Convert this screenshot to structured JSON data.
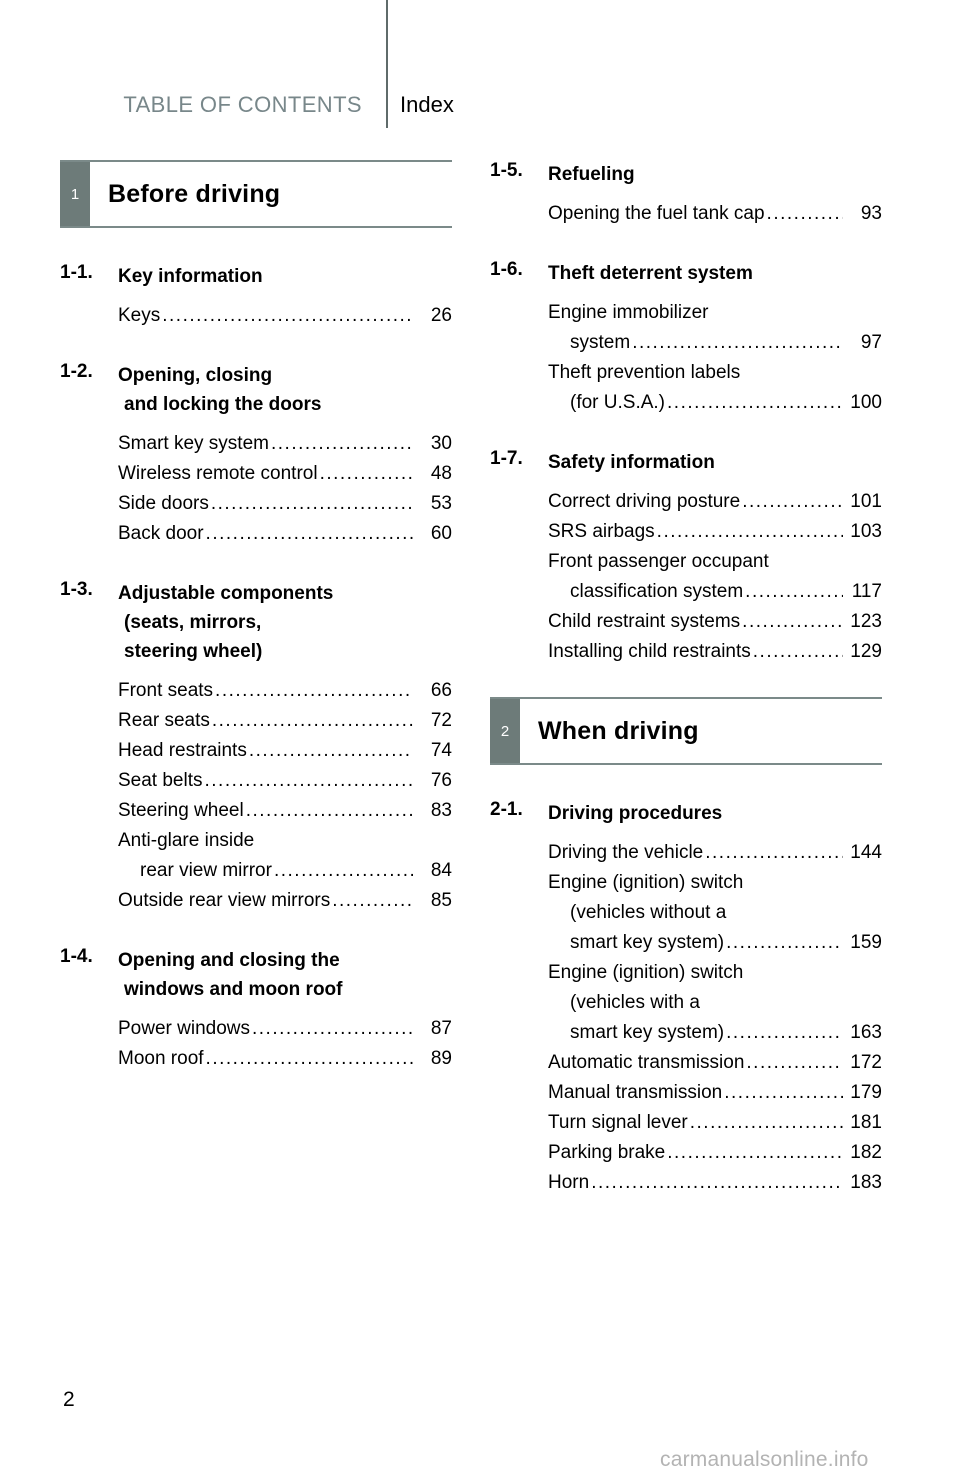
{
  "header": {
    "toc_label": "TABLE OF CONTENTS",
    "index_label": "Index"
  },
  "footer": {
    "page_number": "2",
    "watermark": "carmanualsonline.info"
  },
  "colors": {
    "tab_background": "#6d7b79",
    "rule": "#7b8a89",
    "toc_text": "#78878a",
    "watermark": "#b3b3b3"
  },
  "left_column": {
    "chapter": {
      "number": "1",
      "title": "Before driving"
    },
    "sections": [
      {
        "number": "1-1.",
        "title_lines": [
          "Key information"
        ],
        "entries": [
          {
            "lines": [
              "Keys"
            ],
            "page": "26"
          }
        ]
      },
      {
        "number": "1-2.",
        "title_lines": [
          "Opening, closing",
          "and locking the doors"
        ],
        "entries": [
          {
            "lines": [
              "Smart key system"
            ],
            "page": "30"
          },
          {
            "lines": [
              "Wireless remote control"
            ],
            "page": "48"
          },
          {
            "lines": [
              "Side doors"
            ],
            "page": "53"
          },
          {
            "lines": [
              "Back door"
            ],
            "page": "60"
          }
        ]
      },
      {
        "number": "1-3.",
        "title_lines": [
          "Adjustable components",
          "(seats, mirrors,",
          "steering wheel)"
        ],
        "entries": [
          {
            "lines": [
              "Front seats"
            ],
            "page": "66"
          },
          {
            "lines": [
              "Rear seats"
            ],
            "page": "72"
          },
          {
            "lines": [
              "Head restraints"
            ],
            "page": "74"
          },
          {
            "lines": [
              "Seat belts"
            ],
            "page": "76"
          },
          {
            "lines": [
              "Steering wheel"
            ],
            "page": "83"
          },
          {
            "lines": [
              "Anti-glare inside",
              "rear view mirror"
            ],
            "page": "84"
          },
          {
            "lines": [
              "Outside rear view mirrors"
            ],
            "page": "85"
          }
        ]
      },
      {
        "number": "1-4.",
        "title_lines": [
          "Opening and closing the",
          "windows and moon roof"
        ],
        "entries": [
          {
            "lines": [
              "Power windows"
            ],
            "page": "87"
          },
          {
            "lines": [
              "Moon roof"
            ],
            "page": "89"
          }
        ]
      }
    ]
  },
  "right_column": {
    "sections_before_chapter": [
      {
        "number": "1-5.",
        "title_lines": [
          "Refueling"
        ],
        "entries": [
          {
            "lines": [
              "Opening the fuel tank cap"
            ],
            "page": "93"
          }
        ]
      },
      {
        "number": "1-6.",
        "title_lines": [
          "Theft deterrent system"
        ],
        "entries": [
          {
            "lines": [
              "Engine immobilizer",
              "system"
            ],
            "page": "97"
          },
          {
            "lines": [
              "Theft prevention labels",
              "(for U.S.A.)"
            ],
            "page": "100"
          }
        ]
      },
      {
        "number": "1-7.",
        "title_lines": [
          "Safety information"
        ],
        "entries": [
          {
            "lines": [
              "Correct driving posture"
            ],
            "page": "101"
          },
          {
            "lines": [
              "SRS airbags"
            ],
            "page": "103"
          },
          {
            "lines": [
              "Front passenger occupant",
              "classification system"
            ],
            "page": "117"
          },
          {
            "lines": [
              "Child restraint systems"
            ],
            "page": "123"
          },
          {
            "lines": [
              "Installing child restraints"
            ],
            "page": "129"
          }
        ]
      }
    ],
    "chapter": {
      "number": "2",
      "title": "When driving"
    },
    "sections_after_chapter": [
      {
        "number": "2-1.",
        "title_lines": [
          "Driving procedures"
        ],
        "entries": [
          {
            "lines": [
              "Driving the vehicle"
            ],
            "page": "144"
          },
          {
            "lines": [
              "Engine (ignition) switch",
              "(vehicles without a",
              "smart key system)"
            ],
            "page": "159"
          },
          {
            "lines": [
              "Engine (ignition) switch",
              "(vehicles with a",
              "smart key system)"
            ],
            "page": "163"
          },
          {
            "lines": [
              "Automatic transmission"
            ],
            "page": "172"
          },
          {
            "lines": [
              "Manual transmission"
            ],
            "page": "179"
          },
          {
            "lines": [
              "Turn signal lever"
            ],
            "page": "181"
          },
          {
            "lines": [
              "Parking brake"
            ],
            "page": "182"
          },
          {
            "lines": [
              "Horn"
            ],
            "page": "183"
          }
        ]
      }
    ]
  }
}
